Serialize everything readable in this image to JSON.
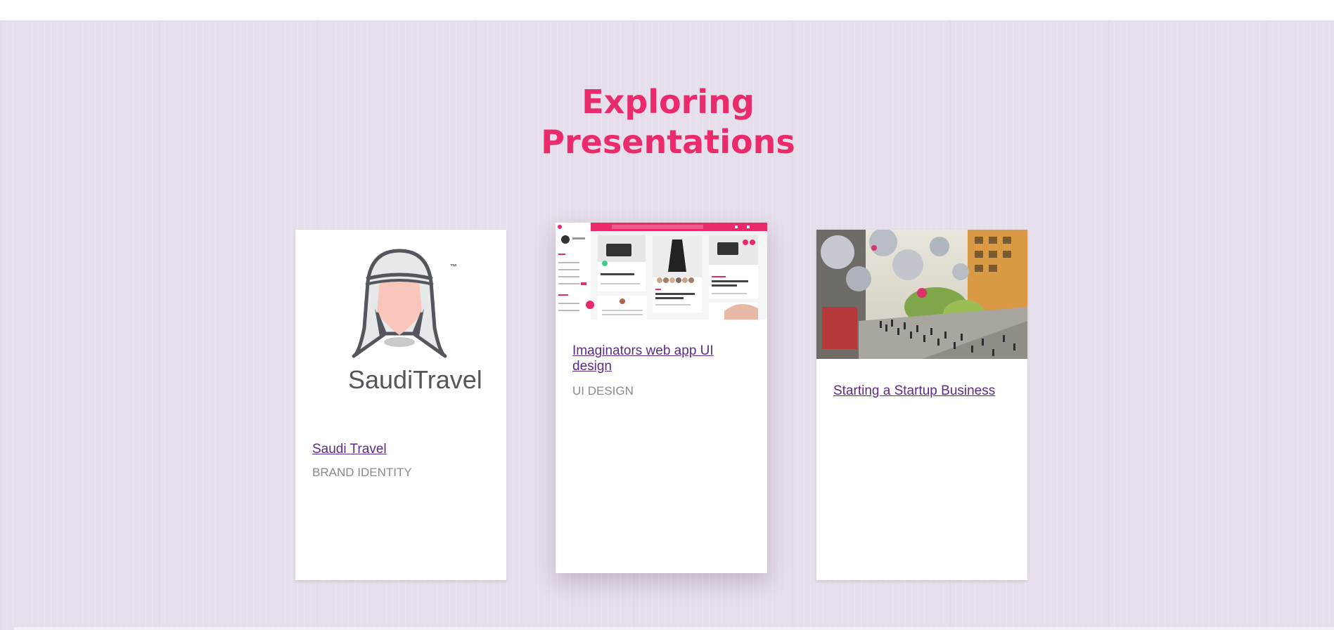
{
  "section": {
    "title_line1": "Exploring",
    "title_line2": "Presentations"
  },
  "colors": {
    "accent": "#ea2a6a",
    "background": "#e6deea",
    "link": "#5d2a85",
    "category": "#8a8a8a"
  },
  "cards": [
    {
      "title": "Saudi Travel",
      "category": "BRAND IDENTITY",
      "thumbnail": "saudi-travel-logo",
      "logo_text": "SaudiTravel",
      "logo_mark": "™"
    },
    {
      "title": "Imaginators web app UI design",
      "category": "UI DESIGN",
      "thumbnail": "web-app-dashboard-screenshot"
    },
    {
      "title": "Starting a Startup Business",
      "category": "",
      "thumbnail": "plaza-crowd-photo"
    }
  ]
}
